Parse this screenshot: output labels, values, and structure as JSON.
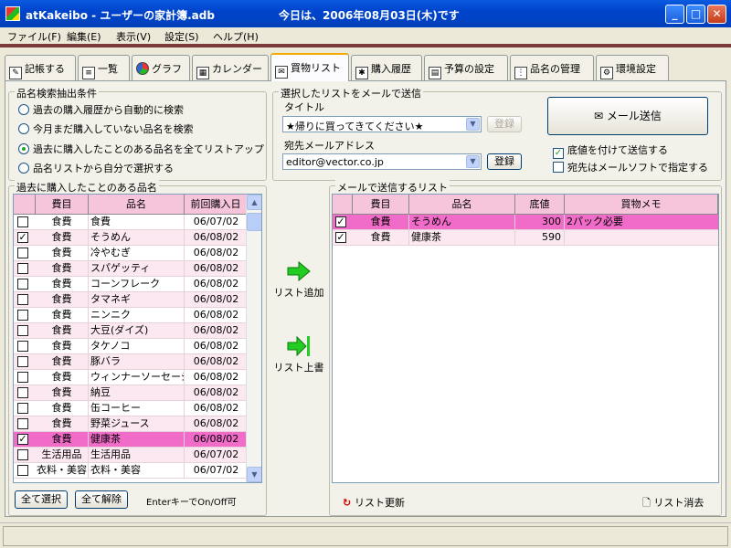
{
  "window": {
    "title": "atKakeibo - ユーザーの家計簿.adb",
    "date_text": "今日は、2006年08月03日(木)です"
  },
  "menu": [
    "ファイル(F)",
    "編集(E)",
    "表示(V)",
    "設定(S)",
    "ヘルプ(H)"
  ],
  "tabs": [
    {
      "label": "記帳する",
      "icon": "pen-icon"
    },
    {
      "label": "一覧",
      "icon": "list-icon"
    },
    {
      "label": "グラフ",
      "icon": "pie-chart-icon"
    },
    {
      "label": "カレンダー",
      "icon": "calendar-icon"
    },
    {
      "label": "買物リスト",
      "icon": "shopping-list-icon",
      "active": true
    },
    {
      "label": "購入履歴",
      "icon": "history-icon"
    },
    {
      "label": "予算の設定",
      "icon": "calculator-icon"
    },
    {
      "label": "品名の管理",
      "icon": "items-icon"
    },
    {
      "label": "環境設定",
      "icon": "settings-icon"
    }
  ],
  "search": {
    "legend": "品名検索抽出条件",
    "options": [
      {
        "label": "過去の購入履歴から自動的に検索",
        "selected": false
      },
      {
        "label": "今月まだ購入していない品名を検索",
        "selected": false
      },
      {
        "label": "過去に購入したことのある品名を全てリストアップ",
        "selected": true
      },
      {
        "label": "品名リストから自分で選択する",
        "selected": false
      }
    ]
  },
  "mail": {
    "legend": "選択したリストをメールで送信",
    "title_label": "タイトル",
    "title_value": "★帰りに買ってきてください★",
    "register_disabled_label": "登録",
    "address_label": "宛先メールアドレス",
    "address_value": "editor@vector.co.jp",
    "register_label": "登録",
    "send_button": "メール送信",
    "check_price": {
      "label": "底値を付けて送信する",
      "checked": true
    },
    "check_mailer": {
      "label": "宛先はメールソフトで指定する",
      "checked": false
    }
  },
  "past_list": {
    "legend": "過去に購入したことのある品名",
    "headers": [
      "",
      "費目",
      "品名",
      "前回購入日"
    ],
    "rows": [
      {
        "checked": false,
        "category": "食費",
        "name": "食費",
        "date": "06/07/02",
        "selected": false
      },
      {
        "checked": true,
        "category": "食費",
        "name": "そうめん",
        "date": "06/08/02",
        "selected": false
      },
      {
        "checked": false,
        "category": "食費",
        "name": "冷やむぎ",
        "date": "06/08/02",
        "selected": false
      },
      {
        "checked": false,
        "category": "食費",
        "name": "スパゲッティ",
        "date": "06/08/02",
        "selected": false
      },
      {
        "checked": false,
        "category": "食費",
        "name": "コーンフレーク",
        "date": "06/08/02",
        "selected": false
      },
      {
        "checked": false,
        "category": "食費",
        "name": "タマネギ",
        "date": "06/08/02",
        "selected": false
      },
      {
        "checked": false,
        "category": "食費",
        "name": "ニンニク",
        "date": "06/08/02",
        "selected": false
      },
      {
        "checked": false,
        "category": "食費",
        "name": "大豆(ダイズ)",
        "date": "06/08/02",
        "selected": false
      },
      {
        "checked": false,
        "category": "食費",
        "name": "タケノコ",
        "date": "06/08/02",
        "selected": false
      },
      {
        "checked": false,
        "category": "食費",
        "name": "豚バラ",
        "date": "06/08/02",
        "selected": false
      },
      {
        "checked": false,
        "category": "食費",
        "name": "ウィンナーソーセージ",
        "date": "06/08/02",
        "selected": false
      },
      {
        "checked": false,
        "category": "食費",
        "name": "納豆",
        "date": "06/08/02",
        "selected": false
      },
      {
        "checked": false,
        "category": "食費",
        "name": "缶コーヒー",
        "date": "06/08/02",
        "selected": false
      },
      {
        "checked": false,
        "category": "食費",
        "name": "野菜ジュース",
        "date": "06/08/02",
        "selected": false
      },
      {
        "checked": true,
        "category": "食費",
        "name": "健康茶",
        "date": "06/08/02",
        "selected": true
      },
      {
        "checked": false,
        "category": "生活用品",
        "name": "生活用品",
        "date": "06/07/02",
        "selected": false
      },
      {
        "checked": false,
        "category": "衣料・美容",
        "name": "衣料・美容",
        "date": "06/07/02",
        "selected": false
      }
    ],
    "select_all": "全て選択",
    "clear_all": "全て解除",
    "hint": "EnterキーでOn/Off可"
  },
  "actions": {
    "add_label": "リスト追加",
    "overwrite_label": "リスト上書"
  },
  "send_list": {
    "legend": "メールで送信するリスト",
    "headers": [
      "",
      "費目",
      "品名",
      "底値",
      "買物メモ"
    ],
    "rows": [
      {
        "checked": true,
        "category": "食費",
        "name": "そうめん",
        "price": "300",
        "memo": "2パック必要",
        "selected": true
      },
      {
        "checked": true,
        "category": "食費",
        "name": "健康茶",
        "price": "590",
        "memo": "",
        "selected": false
      }
    ],
    "refresh_label": "リスト更新",
    "clear_label": "リスト消去"
  },
  "colors": {
    "accent_pink": "#f06cc8",
    "header_pink": "#f6c5dc",
    "title_blue": "#0054e3",
    "arrow_green": "#22cc22"
  }
}
